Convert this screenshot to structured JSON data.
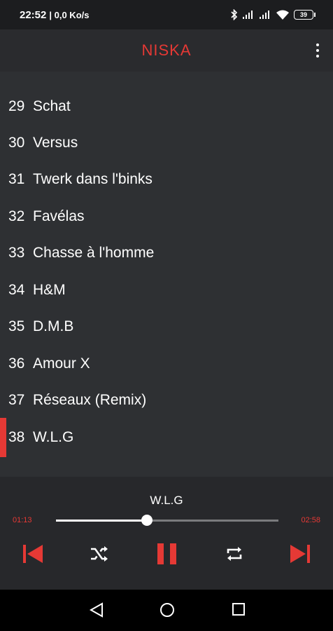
{
  "status_bar": {
    "time": "22:52",
    "speed": "| 0,0 Ko/s",
    "icons": [
      "bluetooth-icon",
      "signal-icon",
      "signal-icon",
      "wifi-icon",
      "battery-icon"
    ],
    "battery": "39"
  },
  "app_bar": {
    "title": "NISKA",
    "menu_icon": "more-vert-icon"
  },
  "tracks": [
    {
      "number": "29",
      "title": "Schat"
    },
    {
      "number": "30",
      "title": "Versus"
    },
    {
      "number": "31",
      "title": "Twerk dans l'binks"
    },
    {
      "number": "32",
      "title": "Favélas"
    },
    {
      "number": "33",
      "title": "Chasse à l'homme"
    },
    {
      "number": "34",
      "title": "H&M"
    },
    {
      "number": "35",
      "title": "D.M.B"
    },
    {
      "number": "36",
      "title": "Amour X"
    },
    {
      "number": "37",
      "title": "Réseaux (Remix)"
    },
    {
      "number": "38",
      "title": "W.L.G",
      "active": true
    }
  ],
  "player": {
    "now_playing": "W.L.G",
    "elapsed": "01:13",
    "duration": "02:58",
    "progress": 0.41,
    "controls": [
      "skip-previous-icon",
      "shuffle-icon",
      "pause-icon",
      "repeat-icon",
      "skip-next-icon"
    ]
  },
  "nav_bar": {
    "buttons": [
      "back-icon",
      "home-icon",
      "recents-icon"
    ]
  },
  "colors": {
    "accent": "#e53935",
    "background": "#2e3033",
    "player_background": "#27282b"
  }
}
